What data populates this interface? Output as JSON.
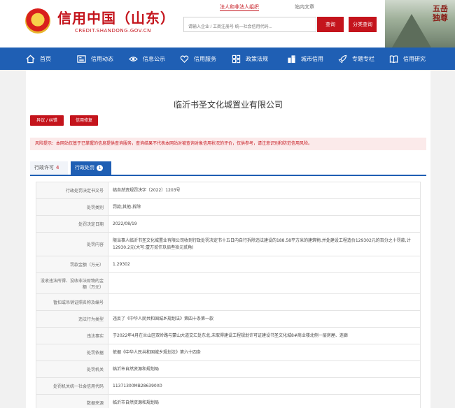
{
  "header": {
    "title": "信用中国（山东）",
    "domain": "CREDIT.SHANDONG.GOV.CN",
    "links": [
      "法人和非法人组织",
      "站内文章"
    ],
    "search_placeholder": "请输入企业 / 工商注册号 统一社会信用代码...",
    "query_label": "查询",
    "category_label": "分类查询",
    "seal_text": "五岳独尊"
  },
  "nav": [
    {
      "label": "首页",
      "icon": "home-icon"
    },
    {
      "label": "信用动态",
      "icon": "news-icon"
    },
    {
      "label": "信息公示",
      "icon": "eye-icon"
    },
    {
      "label": "信用服务",
      "icon": "heart-icon"
    },
    {
      "label": "政策法规",
      "icon": "grid-icon"
    },
    {
      "label": "城市信用",
      "icon": "city-icon"
    },
    {
      "label": "专题专栏",
      "icon": "rocket-icon"
    },
    {
      "label": "信用研究",
      "icon": "book-icon"
    }
  ],
  "company": {
    "name": "临沂书圣文化城置业有限公司",
    "buttons": [
      "异议 / 纠错",
      "信用修复"
    ]
  },
  "risk": {
    "label": "风险提示：",
    "text": "本网站仅基于已掌握的信息提供查询服务，查询结果不代表本网站对被查询对象信用状况的评价，仅供参考，请注意识别和防范信用风险。"
  },
  "tabs": [
    {
      "label": "行政许可",
      "count": "4"
    },
    {
      "label": "行政处罚",
      "count": "1"
    }
  ],
  "details": [
    {
      "key": "行政处罚决定书文号",
      "value": "临自然资规罚决字〔2022〕1203号"
    },
    {
      "key": "处罚类别",
      "value": "罚款;其他-拆除"
    },
    {
      "key": "处罚决定日期",
      "value": "2022/08/19"
    },
    {
      "key": "处罚内容",
      "value": "限当事人临沂书圣文化城置业有限公司收到行政处罚决定书十五日内自行拆除违法建设的188.58平方米的建筑物,并处建设工程造价129302元的百分之十罚款,计12930.2元(大写:壹万贰仟玖佰叁拾元贰角)"
    },
    {
      "key": "罚款金额（万元）",
      "value": "1.29302"
    },
    {
      "key": "没收违法所得、没收非法财物的金额（万元）",
      "value": ""
    },
    {
      "key": "暂扣或吊销证照名称及编号",
      "value": ""
    },
    {
      "key": "违法行为类型",
      "value": "违反了《中华人民共和国城乡规划法》第四十条第一款"
    },
    {
      "key": "违法事实",
      "value": "于2022年4月在兰山区双岭路与蒙山大道交汇处东北,未取得建设工程规划许可证建设书圣文化城8#商业楼北侧一层房屋、连廊"
    },
    {
      "key": "处罚依据",
      "value": "依据《中华人民共和国城乡规划法》第六十四条"
    },
    {
      "key": "处罚机关",
      "value": "临沂市自然资源和规划局"
    },
    {
      "key": "处罚机关统一社会信用代码",
      "value": "11371300MB286390X0"
    },
    {
      "key": "数据来源",
      "value": "临沂市自然资源和规划局"
    }
  ],
  "colors": {
    "brand_red": "#c4141c",
    "nav_blue": "#1f5fb4"
  }
}
